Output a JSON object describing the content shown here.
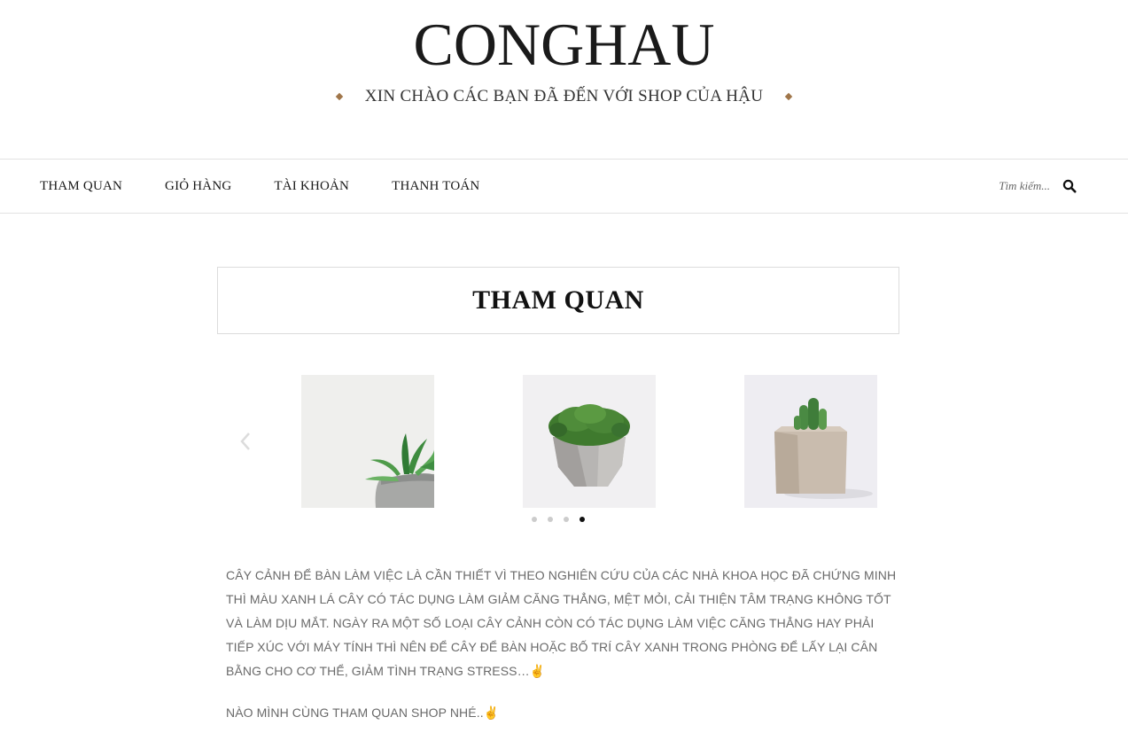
{
  "site": {
    "title": "CONGHAU",
    "tagline": "XIN CHÀO CÁC BẠN ĐÃ ĐẾN VỚI SHOP CỦA HẬU"
  },
  "nav": {
    "items": [
      {
        "label": "THAM QUAN"
      },
      {
        "label": "GIỎ HÀNG"
      },
      {
        "label": "TÀI KHOẢN"
      },
      {
        "label": "THANH TOÁN"
      }
    ],
    "search": {
      "placeholder": "Tìm kiếm...",
      "icon": "search-icon"
    }
  },
  "page": {
    "title": "THAM QUAN"
  },
  "carousel": {
    "prev_icon": "chevron-left-icon",
    "slides": [
      {
        "image": "succulent-in-concrete-pot"
      },
      {
        "image": "moss-in-geometric-concrete-pot"
      },
      {
        "image": "cactus-in-square-pot"
      }
    ],
    "dots_total": 4,
    "active_dot": 4
  },
  "content": {
    "paragraph1": "CÂY CẢNH ĐỂ BÀN LÀM VIỆC LÀ CẦN THIẾT VÌ THEO NGHIÊN CỨU CỦA CÁC NHÀ KHOA HỌC ĐÃ CHỨNG MINH THÌ MÀU XANH LÁ CÂY CÓ TÁC DỤNG LÀM GIẢM CĂNG THẲNG, MỆT MỎI, CẢI THIỆN TÂM TRẠNG KHÔNG TỐT VÀ LÀM DỊU MẮT. NGÀY RA MỘT SỐ  LOẠI CÂY CẢNH CÒN CÓ TÁC DỤNG LÀM VIỆC CĂNG THẲNG HAY PHẢI TIẾP XÚC VỚI MÁY TÍNH THÌ NÊN ĐỂ CÂY ĐỂ BÀN HOẶC BỐ TRÍ CÂY XANH TRONG PHÒNG ĐỂ LẤY LẠI CÂN BẰNG CHO CƠ THỂ, GIẢM TÌNH TRẠNG STRESS…",
    "paragraph2": "NÀO MÌNH CÙNG THAM QUAN SHOP NHÉ..",
    "emoji": "✌"
  },
  "colors": {
    "accent": "#a0764a",
    "text_muted": "#6a6a6a",
    "border": "#e2e2e2"
  }
}
